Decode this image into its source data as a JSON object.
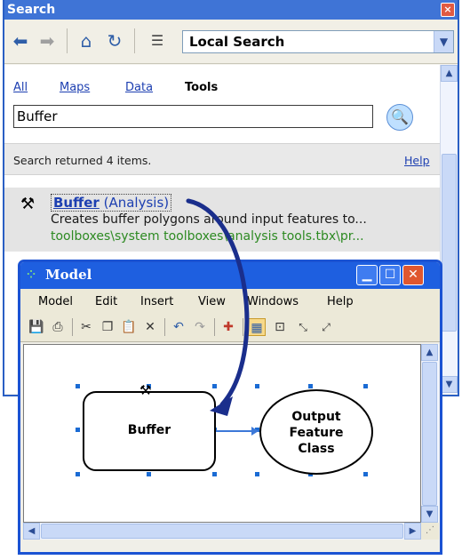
{
  "search": {
    "title": "Search",
    "close_glyph": "×",
    "location": "Local Search",
    "tabs": [
      "All",
      "Maps",
      "Data",
      "Tools"
    ],
    "query": "Buffer",
    "status": "Search returned 4 items.",
    "help": "Help",
    "result": {
      "name_bold": "Buffer",
      "name_rest": " (Analysis)",
      "description": "Creates buffer polygons around input features to...",
      "path": "toolboxes\\system toolboxes\\analysis tools.tbx\\pr..."
    }
  },
  "model": {
    "title": "Model",
    "menu": [
      "Model",
      "Edit",
      "Insert",
      "View",
      "Windows",
      "Help"
    ],
    "tool_node": "Buffer",
    "output_node": [
      "Output",
      "Feature",
      "Class"
    ]
  },
  "colors": {
    "title_bar": "#3f74d6",
    "model_title_bar": "#1e5fe0",
    "link_blue": "#1d3fb1",
    "path_green": "#2d8a22",
    "arrow_navy": "#1a2e8c"
  },
  "icons": [
    "back-arrow-icon",
    "forward-arrow-icon",
    "home-icon",
    "refresh-icon",
    "list-view-icon",
    "search-go-icon",
    "hammer-tool-icon"
  ]
}
